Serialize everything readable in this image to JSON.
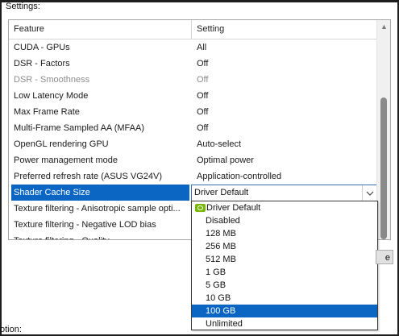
{
  "settings_label": "Settings:",
  "columns": {
    "feature": "Feature",
    "setting": "Setting"
  },
  "rows": [
    {
      "feature": "CUDA - GPUs",
      "setting": "All"
    },
    {
      "feature": "DSR - Factors",
      "setting": "Off"
    },
    {
      "feature": "DSR - Smoothness",
      "setting": "Off",
      "disabled": true
    },
    {
      "feature": "Low Latency Mode",
      "setting": "Off"
    },
    {
      "feature": "Max Frame Rate",
      "setting": "Off"
    },
    {
      "feature": "Multi-Frame Sampled AA (MFAA)",
      "setting": "Off"
    },
    {
      "feature": "OpenGL rendering GPU",
      "setting": "Auto-select"
    },
    {
      "feature": "Power management mode",
      "setting": "Optimal power"
    },
    {
      "feature": "Preferred refresh rate (ASUS VG24V)",
      "setting": "Application-controlled"
    },
    {
      "feature": "Shader Cache Size",
      "setting": "Driver Default",
      "selected": true
    },
    {
      "feature": "Texture filtering - Anisotropic sample opti...",
      "setting": ""
    },
    {
      "feature": "Texture filtering - Negative LOD bias",
      "setting": ""
    },
    {
      "feature": "Texture filtering - Quality",
      "setting": ""
    }
  ],
  "combo": {
    "value": "Driver Default",
    "arrow_icon": "chevron-down-icon"
  },
  "dropdown": {
    "header": "Driver Default",
    "options": [
      "Disabled",
      "128 MB",
      "256 MB",
      "512 MB",
      "1 GB",
      "5 GB",
      "10 GB",
      "100 GB",
      "Unlimited"
    ],
    "selected": "100 GB"
  },
  "restore_button": "e",
  "description_label": "otion:",
  "colors": {
    "selection": "#0a66c2",
    "nvidia_green": "#76b900"
  }
}
